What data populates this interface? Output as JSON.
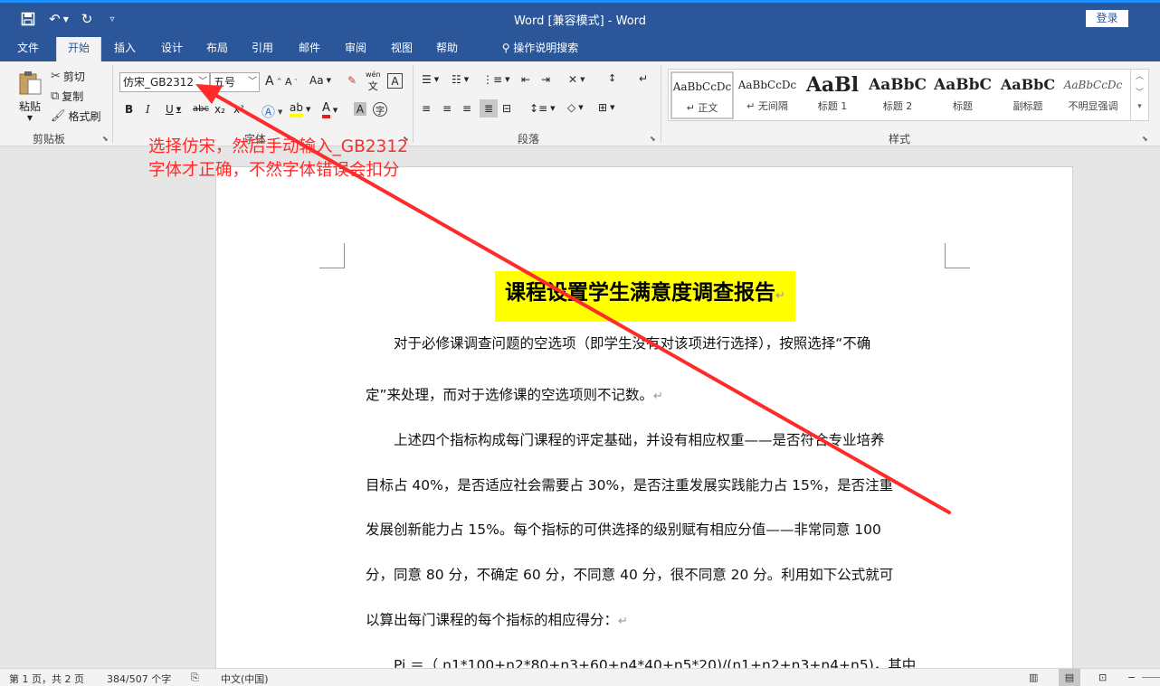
{
  "titlebar": {
    "title": "Word [兼容模式]  -  Word",
    "login_label": "登录",
    "qat": [
      "save-icon",
      "undo-icon",
      "redo-icon",
      "customize-qat-icon"
    ]
  },
  "tabs": [
    "文件",
    "开始",
    "插入",
    "设计",
    "布局",
    "引用",
    "邮件",
    "审阅",
    "视图",
    "帮助",
    "操作说明搜索"
  ],
  "active_tab": "开始",
  "ribbon": {
    "clipboard": {
      "paste": "粘贴",
      "cut": "剪切",
      "copy": "复制",
      "format_painter": "格式刷",
      "label": "剪贴板"
    },
    "font": {
      "font_name": "仿宋_GB2312",
      "font_size": "五号",
      "label": "字体",
      "buttons": [
        "B",
        "I",
        "U",
        "abc",
        "x₂",
        "x²"
      ],
      "case_button": "Aa",
      "phonetic": "wén",
      "grow": "A",
      "shrink": "A"
    },
    "paragraph": {
      "label": "段落"
    },
    "styles": {
      "label": "样式",
      "items": [
        {
          "preview": "AaBbCcDc",
          "name": "↵ 正文"
        },
        {
          "preview": "AaBbCcDc",
          "name": "↵ 无间隔"
        },
        {
          "preview": "AaBl",
          "name": "标题 1"
        },
        {
          "preview": "AaBbC",
          "name": "标题 2"
        },
        {
          "preview": "AaBbC",
          "name": "标题"
        },
        {
          "preview": "AaBbC",
          "name": "副标题"
        },
        {
          "preview": "AaBbCcDc",
          "name": "不明显强调"
        }
      ]
    }
  },
  "document": {
    "heading": "课程设置学生满意度调查报告",
    "paragraphs": [
      "　　对于必修课调查问题的空选项（即学生没有对该项进行选择），按照选择“不确",
      "定”来处理，而对于选修课的空选项则不记数。",
      "　　上述四个指标构成每门课程的评定基础，并设有相应权重——是否符合专业培养",
      "目标占 40%，是否适应社会需要占 30%，是否注重发展实践能力占 15%，是否注重",
      "发展创新能力占 15%。每个指标的可供选择的级别赋有相应分值——非常同意 100",
      "分，同意 80 分，不确定 60 分，不同意 40 分，很不同意 20 分。利用如下公式就可",
      "以算出每门课程的每个指标的相应得分：",
      "　　Pi ＝（ n1*100+n2*80+n3+60+n4*40+n5*20)/(n1+n2+n3+n4+n5)，其中"
    ],
    "paragraph_mark": "↵"
  },
  "annotation": {
    "line1": "选择仿宋，然后手动输入_GB2312",
    "line2": "字体才正确，不然字体错误会扣分",
    "color": "#ff2a2a"
  },
  "statusbar": {
    "page": "第 1 页，共 2 页",
    "words": "384/507 个字",
    "language": "中文(中国)",
    "zoom_minus": "−"
  },
  "colors": {
    "title_bar": "#2b579a",
    "ribbon": "#f3f3f3",
    "highlight": "#ffff00"
  }
}
